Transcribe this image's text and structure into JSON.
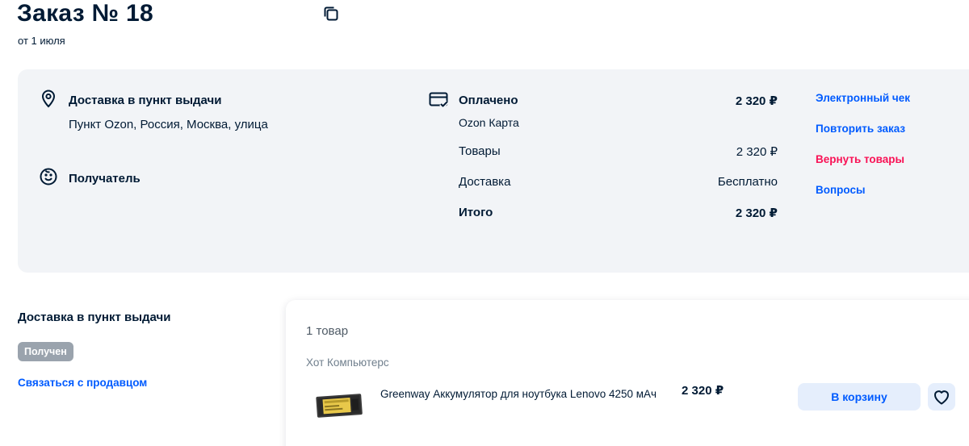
{
  "header": {
    "title": "Заказ № 18",
    "date": "от 1 июля"
  },
  "delivery": {
    "label": "Доставка в пункт выдачи",
    "address": "Пункт Ozon, Россия, Москва, улица",
    "recipient_label": "Получатель"
  },
  "payment": {
    "status": "Оплачено",
    "status_amount": "2 320 ₽",
    "method": "Ozon Карта",
    "goods_label": "Товары",
    "goods_amount": "2 320 ₽",
    "shipping_label": "Доставка",
    "shipping_value": "Бесплатно",
    "total_label": "Итого",
    "total_amount": "2 320 ₽"
  },
  "actions": {
    "receipt": "Электронный чек",
    "repeat": "Повторить заказ",
    "return": "Вернуть товары",
    "questions": "Вопросы"
  },
  "shipment": {
    "heading": "Доставка в пункт выдачи",
    "status": "Получен",
    "contact_seller": "Связаться с продавцом"
  },
  "items": {
    "count_label": "1 товар",
    "seller": "Хот Компьютерс",
    "product_name": "Greenway Аккумулятор для ноутбука Lenovo 4250 мАч",
    "product_price": "2 320 ₽",
    "cart_label": "В корзину"
  },
  "colors": {
    "accent": "#005bff",
    "danger": "#f91155",
    "text": "#001a34",
    "panel": "#f2f4f7"
  }
}
